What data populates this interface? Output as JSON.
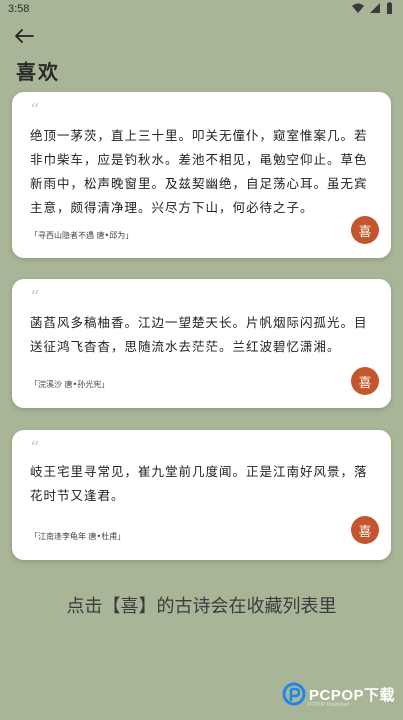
{
  "status_bar": {
    "time": "3:58"
  },
  "header": {
    "title": "喜欢"
  },
  "cards": [
    {
      "quote_mark": "“",
      "text": "绝顶一茅茨，直上三十里。叩关无僮仆，窥室惟案几。若非巾柴车，应是钓秋水。差池不相见，黾勉空仰止。草色新雨中，松声晚窗里。及兹契幽绝，自足荡心耳。虽无宾主意，颇得清净理。兴尽方下山，何必待之子。",
      "source": "「寻西山隐者不遇 唐•邱为」",
      "like_label": "喜"
    },
    {
      "quote_mark": "“",
      "text": "菡萏风多稿柚香。江边一望楚天长。片帆烟际闪孤光。目送征鸿飞杳杳，思随流水去茫茫。兰红波碧忆潇湘。",
      "source": "「浣溪沙 唐•孙光宪」",
      "like_label": "喜"
    },
    {
      "quote_mark": "“",
      "text": "岐王宅里寻常见，崔九堂前几度闻。正是江南好风景，落花时节又逢君。",
      "source": "「江南逢李龟年 唐•杜甫」",
      "like_label": "喜"
    }
  ],
  "caption": "点击【喜】的古诗会在收藏列表里",
  "watermark": {
    "text": "PCPOP下载",
    "sub": "PCPOP Download"
  },
  "colors": {
    "background": "#a9b597",
    "like_button": "#c4562d",
    "card": "#ffffff"
  }
}
